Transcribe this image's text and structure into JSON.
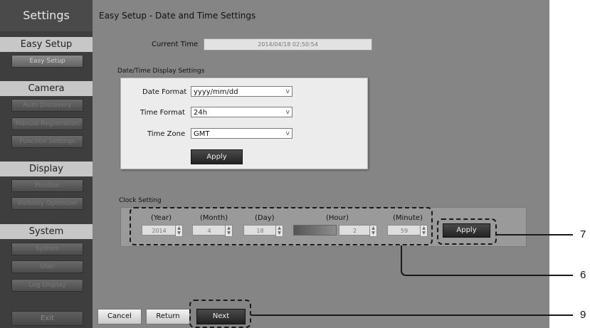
{
  "sidebar": {
    "title": "Settings",
    "sections": [
      {
        "heading": "Easy Setup",
        "items": [
          "Easy Setup"
        ]
      },
      {
        "heading": "Camera",
        "items": [
          "Auto Discovery",
          "Manual Registration",
          "Function Settings"
        ]
      },
      {
        "heading": "Display",
        "items": [
          "Position",
          "Visibility Optimizer"
        ]
      },
      {
        "heading": "System",
        "items": [
          "System",
          "User",
          "Log Display"
        ]
      }
    ],
    "exit_label": "Exit"
  },
  "main": {
    "title": "Easy Setup - Date and Time Settings",
    "current_time_label": "Current Time",
    "current_time_value": "2014/04/18 02:50:54",
    "display_settings": {
      "heading": "Date/Time Display Settings",
      "date_format_label": "Date Format",
      "date_format_value": "yyyy/mm/dd",
      "time_format_label": "Time Format",
      "time_format_value": "24h",
      "time_zone_label": "Time Zone",
      "time_zone_value": "GMT",
      "apply_label": "Apply"
    },
    "clock": {
      "heading": "Clock Setting",
      "year_label": "(Year)",
      "year_value": "2014",
      "month_label": "(Month)",
      "month_value": "4",
      "day_label": "(Day)",
      "day_value": "18",
      "hour_label": "(Hour)",
      "hour_value": "2",
      "minute_label": "(Minute)",
      "minute_value": "59",
      "apply_label": "Apply"
    },
    "footer": {
      "cancel": "Cancel",
      "return": "Return",
      "next": "Next"
    }
  },
  "callouts": {
    "c7": "7",
    "c6": "6",
    "c9": "9"
  },
  "icons": {
    "dropdown": "v",
    "stepper": "up-down-arrows"
  }
}
